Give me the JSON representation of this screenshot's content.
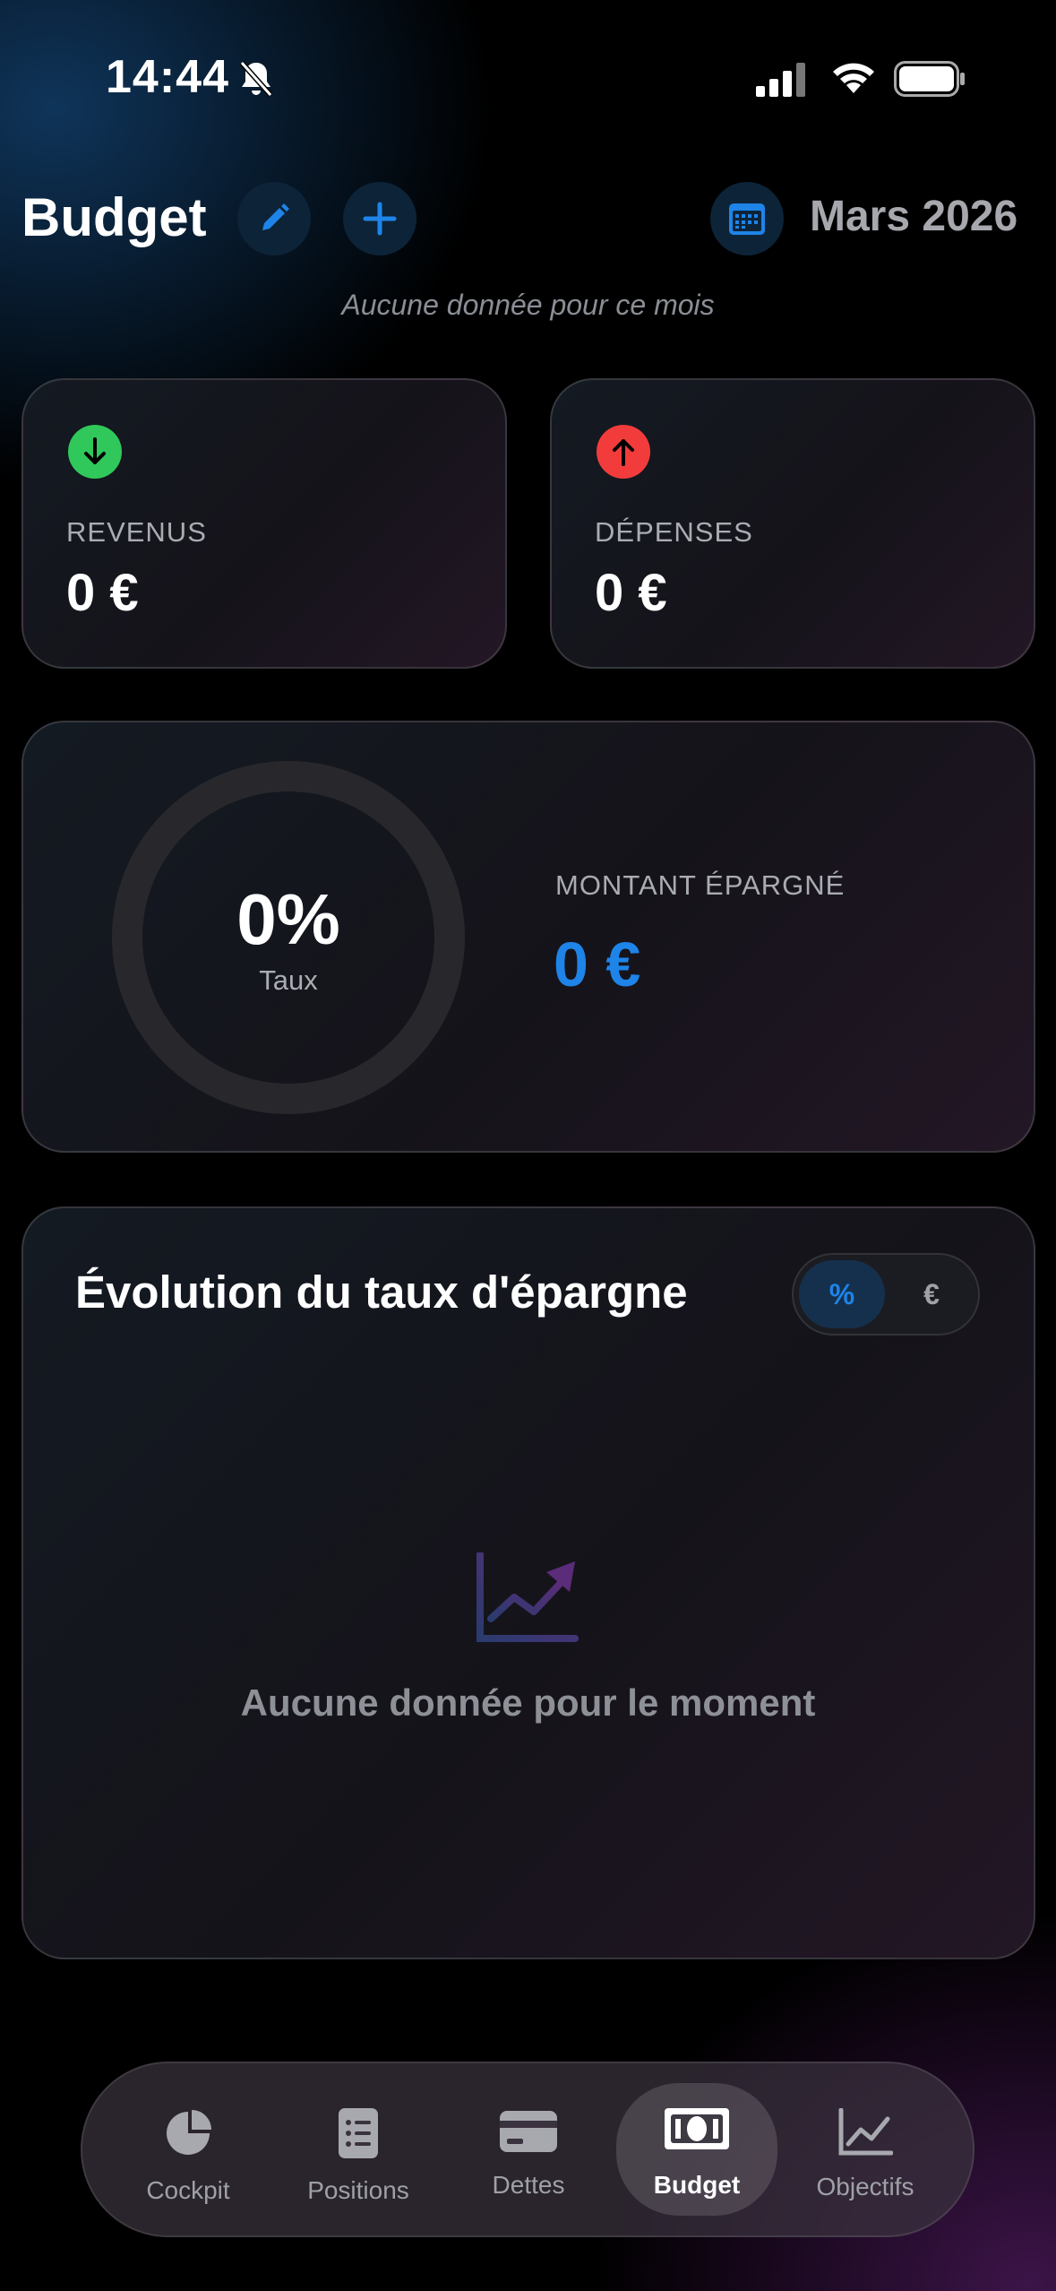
{
  "status_bar": {
    "time": "14:44"
  },
  "header": {
    "title": "Budget",
    "month": "Mars 2026",
    "subtitle": "Aucune donnée pour ce mois"
  },
  "income_card": {
    "label": "REVENUS",
    "value": "0 €",
    "icon": "arrow-down-icon",
    "color": "#30c85a"
  },
  "expense_card": {
    "label": "DÉPENSES",
    "value": "0 €",
    "icon": "arrow-up-icon",
    "color": "#f23c3c"
  },
  "savings_card": {
    "rate": "0%",
    "rate_label": "Taux",
    "rate_fraction": 0,
    "amount_label": "MONTANT ÉPARGNÉ",
    "amount": "0 €",
    "accent": "#1e84e8"
  },
  "chart_card": {
    "title": "Évolution du taux d'épargne",
    "toggle": {
      "options": [
        "%",
        "€"
      ],
      "selected": "%"
    },
    "empty_message": "Aucune donnée pour le moment",
    "empty_icon": "chart-line-icon"
  },
  "tab_bar": {
    "tabs": [
      {
        "label": "Cockpit",
        "icon": "pie-chart-icon"
      },
      {
        "label": "Positions",
        "icon": "list-icon"
      },
      {
        "label": "Dettes",
        "icon": "credit-card-icon"
      },
      {
        "label": "Budget",
        "icon": "banknote-icon",
        "active": true
      },
      {
        "label": "Objectifs",
        "icon": "chart-line-icon"
      }
    ]
  }
}
